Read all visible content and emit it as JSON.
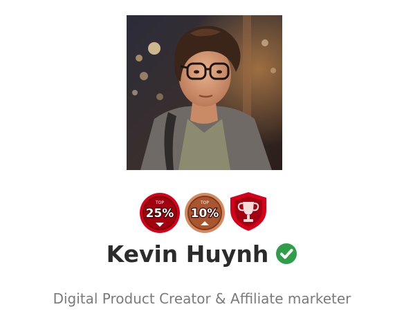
{
  "profile": {
    "name": "Kevin Huynh",
    "tagline": "Digital Product Creator & Affiliate marketer",
    "avatar_icon": "profile-photo",
    "verified_icon": "check-circle-icon",
    "verified_color": "#2e9e49"
  },
  "badges": [
    {
      "label_top": "TOP",
      "label_pct": "25%",
      "icon": "top-25-badge-icon",
      "color": "#c0000e"
    },
    {
      "label_top": "TOP",
      "label_pct": "10%",
      "icon": "top-10-badge-icon",
      "color": "#b8734d"
    },
    {
      "icon": "trophy-badge-icon",
      "color": "#c0000e"
    }
  ]
}
